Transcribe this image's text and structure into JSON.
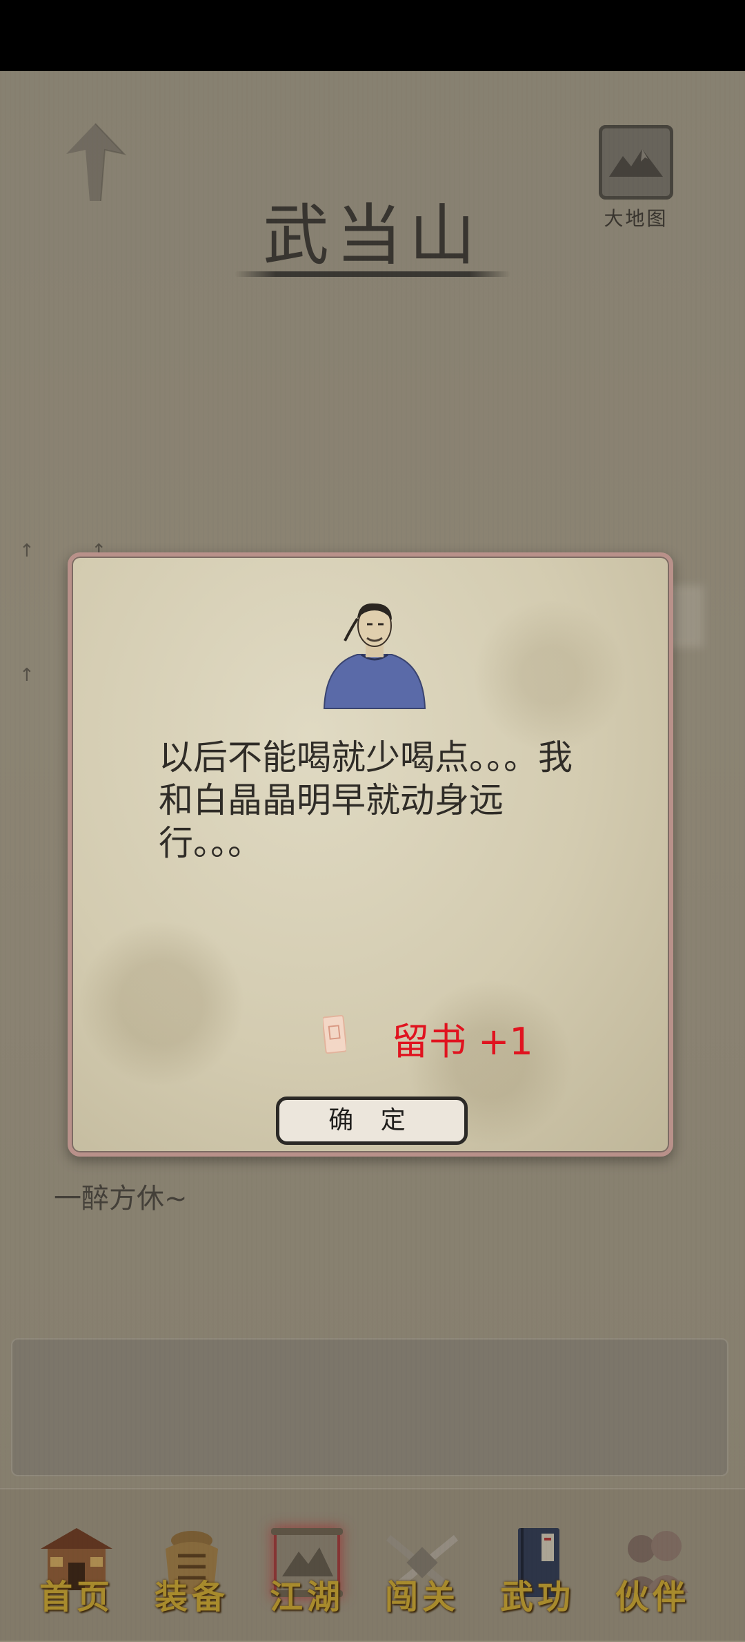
{
  "header": {
    "title": "武当山",
    "map_label": "大地图"
  },
  "chat": {
    "last_line": "一醉方休~"
  },
  "dialog": {
    "message": "以后不能喝就少喝点。。。我和白晶晶明早就动身远行。。。",
    "reward_text": "留书 +1",
    "confirm_label": "确 定"
  },
  "nav": {
    "items": [
      {
        "label": "首页",
        "icon": "home-building-icon"
      },
      {
        "label": "装备",
        "icon": "armor-icon"
      },
      {
        "label": "江湖",
        "icon": "scroll-map-icon"
      },
      {
        "label": "闯关",
        "icon": "crossed-swords-icon"
      },
      {
        "label": "武功",
        "icon": "martial-book-icon"
      },
      {
        "label": "伙伴",
        "icon": "companions-icon"
      }
    ],
    "active_index": 2
  },
  "colors": {
    "reward": "#e0131f",
    "nav_label": "#c5a331",
    "background": "#9d9684"
  }
}
